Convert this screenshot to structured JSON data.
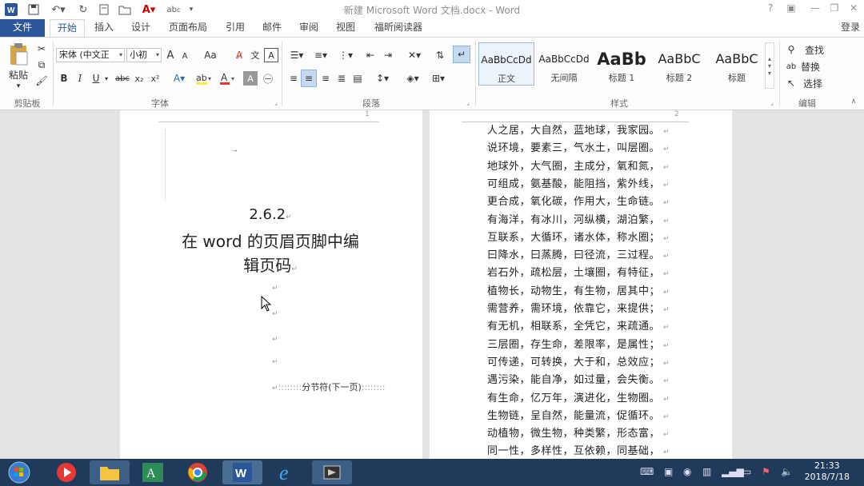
{
  "window": {
    "title": "新建 Microsoft Word 文档.docx - Word",
    "help": "?",
    "login": "登录"
  },
  "tabs": [
    "文件",
    "开始",
    "插入",
    "设计",
    "页面布局",
    "引用",
    "邮件",
    "审阅",
    "视图",
    "福昕阅读器"
  ],
  "ribbon": {
    "clipboard": {
      "paste_label": "粘贴",
      "group": "剪贴板"
    },
    "font": {
      "font_name": "宋体 (中文正",
      "font_size": "小初",
      "grow": "A",
      "shrink": "A",
      "case": "Aa",
      "bold": "B",
      "italic": "I",
      "underline": "U",
      "strike": "abc",
      "sub": "x₂",
      "sup": "x²",
      "group": "字体"
    },
    "paragraph": {
      "group": "段落"
    },
    "styles": {
      "group": "样式",
      "items": [
        {
          "sample": "AaBbCcDd",
          "name": "正文"
        },
        {
          "sample": "AaBbCcDd",
          "name": "无间隔"
        },
        {
          "sample": "AaBb",
          "name": "标题 1"
        },
        {
          "sample": "AaBbC",
          "name": "标题 2"
        },
        {
          "sample": "AaBbC",
          "name": "标题"
        }
      ]
    },
    "editing": {
      "find": "查找",
      "replace": "替换",
      "select": "选择",
      "group": "编辑"
    }
  },
  "document": {
    "left_page": {
      "page_number": "1",
      "heading_number": "2.6.2",
      "heading_line1": "在 word 的页眉页脚中编",
      "heading_line2": "辑页码",
      "section_break": "分节符(下一页)"
    },
    "right_page": {
      "page_number": "2",
      "lines": [
        "人之居，大自然，蓝地球，我家园。",
        "说环境，要素三，气水土，叫层圈。",
        "地球外，大气圈，主成分，氧和氮，",
        "可组成，氨基酸，能阻挡，紫外线，",
        "更合成，氧化碳，作用大，生命链。",
        "有海洋，有冰川，河纵横，湖泊繁，",
        "互联系，大循环，诸水体，称水圈；",
        "曰降水，曰蒸腾，曰径流，三过程。",
        "岩石外，疏松层，土壤圈，有特征，",
        "植物长，动物生，有生物，居其中；",
        "需营养，需环境，依靠它，来提供；",
        "有无机，相联系，全凭它，来疏通。",
        "三层圈，存生命，差限率，是属性；",
        "可传递，可转换，大于和，总效应；",
        "遇污染，能自净，如过量，会失衡。",
        "有生命，亿万年，演进化，生物圈。",
        "生物链，呈自然，能量流，促循环。",
        "动植物，微生物，种类繁，形态富，",
        "同一性，多样性，互依赖，同基础，"
      ]
    }
  },
  "taskbar": {
    "time": "21:33",
    "date": "2018/7/18"
  },
  "colors": {
    "word_blue": "#2b579a",
    "taskbar": "#1f3a5a"
  }
}
